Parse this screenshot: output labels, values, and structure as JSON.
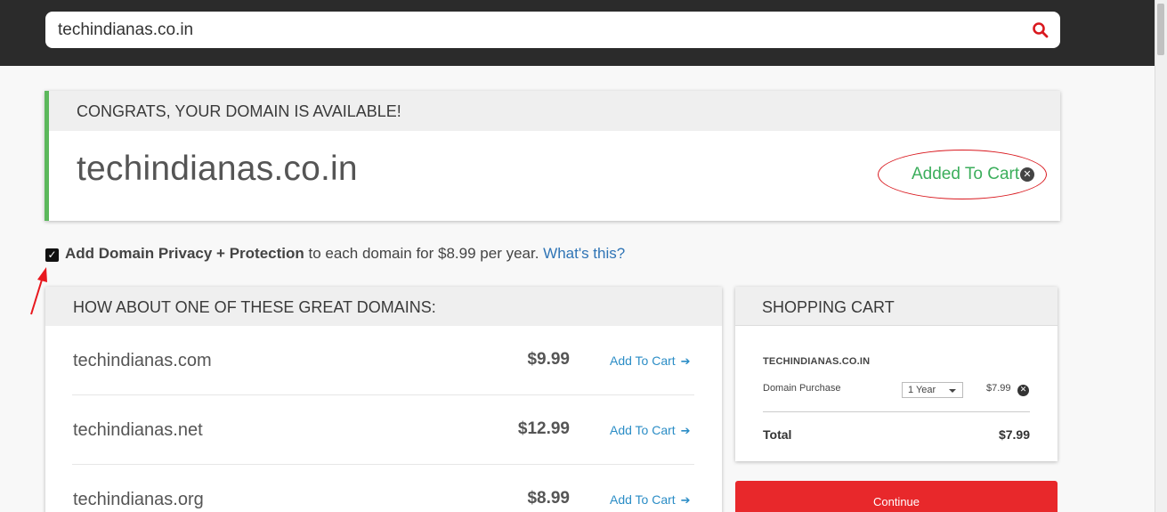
{
  "search": {
    "value": "techindianas.co.in",
    "icon": "search-icon"
  },
  "availability": {
    "heading": "CONGRATS, YOUR DOMAIN IS AVAILABLE!",
    "domain": "techindianas.co.in",
    "added_label": "Added To Cart",
    "accent_color": "#5cb85c"
  },
  "privacy": {
    "checked": true,
    "bold_text": "Add Domain Privacy + Protection",
    "text": " to each domain for $8.99 per year. ",
    "link": "What's this?"
  },
  "suggestions": {
    "heading": "HOW ABOUT ONE OF THESE GREAT DOMAINS:",
    "items": [
      {
        "name": "techindianas.com",
        "price": "$9.99",
        "action": "Add To Cart"
      },
      {
        "name": "techindianas.net",
        "price": "$12.99",
        "action": "Add To Cart"
      },
      {
        "name": "techindianas.org",
        "price": "$8.99",
        "action": "Add To Cart"
      }
    ]
  },
  "cart": {
    "heading": "SHOPPING CART",
    "item_name": "TECHINDIANAS.CO.IN",
    "item_type": "Domain Purchase",
    "term": "1 Year",
    "item_price": "$7.99",
    "total_label": "Total",
    "total_value": "$7.99",
    "continue_label": "Continue"
  }
}
